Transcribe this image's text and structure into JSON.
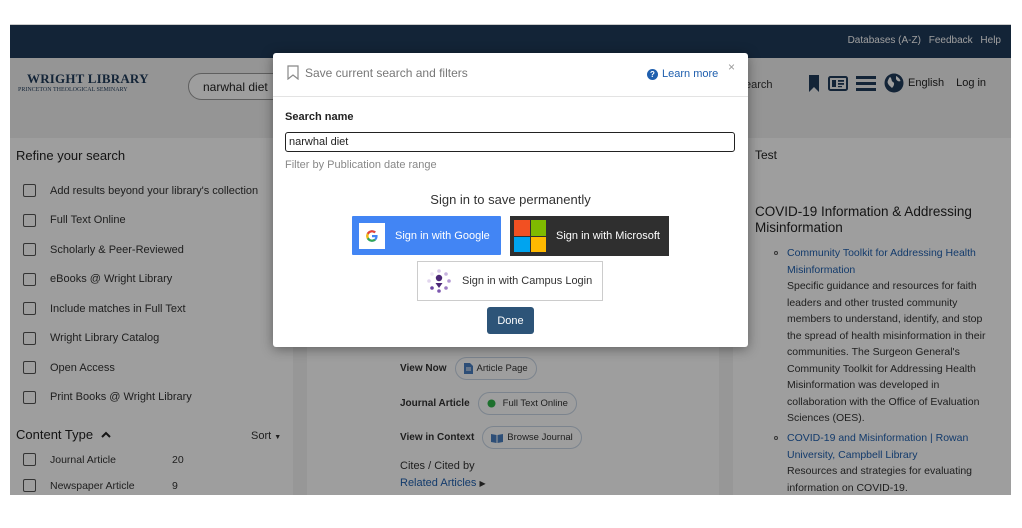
{
  "topbar": {
    "links": [
      "Databases (A-Z)",
      "Feedback",
      "Help"
    ]
  },
  "header": {
    "logo_main": "WRIGHT LIBRARY",
    "logo_sub": "PRINCETON THEOLOGICAL SEMINARY",
    "search_value": "narwhal diet",
    "search_tail": "earch",
    "language": "English",
    "login": "Log in"
  },
  "refine": {
    "title": "Refine your search",
    "filters": [
      "Add results beyond your library's collection",
      "Full Text Online",
      "Scholarly & Peer-Reviewed",
      "eBooks @ Wright Library",
      "Include matches in Full Text",
      "Wright Library Catalog",
      "Open Access",
      "Print Books @ Wright Library"
    ]
  },
  "content_type": {
    "title": "Content Type",
    "sort": "Sort",
    "rows": [
      {
        "label": "Journal Article",
        "count": "20"
      },
      {
        "label": "Newspaper Article",
        "count": "9"
      }
    ]
  },
  "result": {
    "view_now_label": "View Now",
    "article_page": "Article Page",
    "journal_article_label": "Journal Article",
    "full_text_online": "Full Text Online",
    "view_in_context_label": "View in Context",
    "browse_journal": "Browse Journal",
    "cites": "Cites / Cited by",
    "related": "Related Articles"
  },
  "sidebar": {
    "test": "Test",
    "title": "COVID-19 Information & Addressing Misinformation",
    "items": [
      {
        "link": "Community Toolkit for Addressing Health Misinformation",
        "desc": "Specific guidance and resources for faith leaders and other trusted community members to understand, identify, and stop the spread of health misinformation in their communities. The Surgeon General's Community Toolkit for Addressing Health Misinformation was developed in collaboration with the Office of Evaluation Sciences (OES)."
      },
      {
        "link": "COVID-19 and Misinformation | Rowan University, Campbell Library",
        "desc": "Resources and strategies for evaluating information on COVID-19."
      }
    ]
  },
  "modal": {
    "title": "Save current search and filters",
    "learn_more": "Learn more",
    "close": "×",
    "search_name_label": "Search name",
    "search_name_value": "narwhal diet",
    "filter_text": "Filter by Publication date range",
    "sign_in_text": "Sign in to save permanently",
    "google_label": "Sign in with Google",
    "microsoft_label": "Sign in with Microsoft",
    "campus_label": "Sign in with Campus Login",
    "done_label": "Done"
  },
  "colors": {
    "navy": "#1f3a5a",
    "link_blue": "#1f5fae",
    "google_blue": "#4285f4",
    "microsoft_dark": "#2f2f2f",
    "done_blue": "#2d5478",
    "full_text_green": "#2fb54a"
  }
}
